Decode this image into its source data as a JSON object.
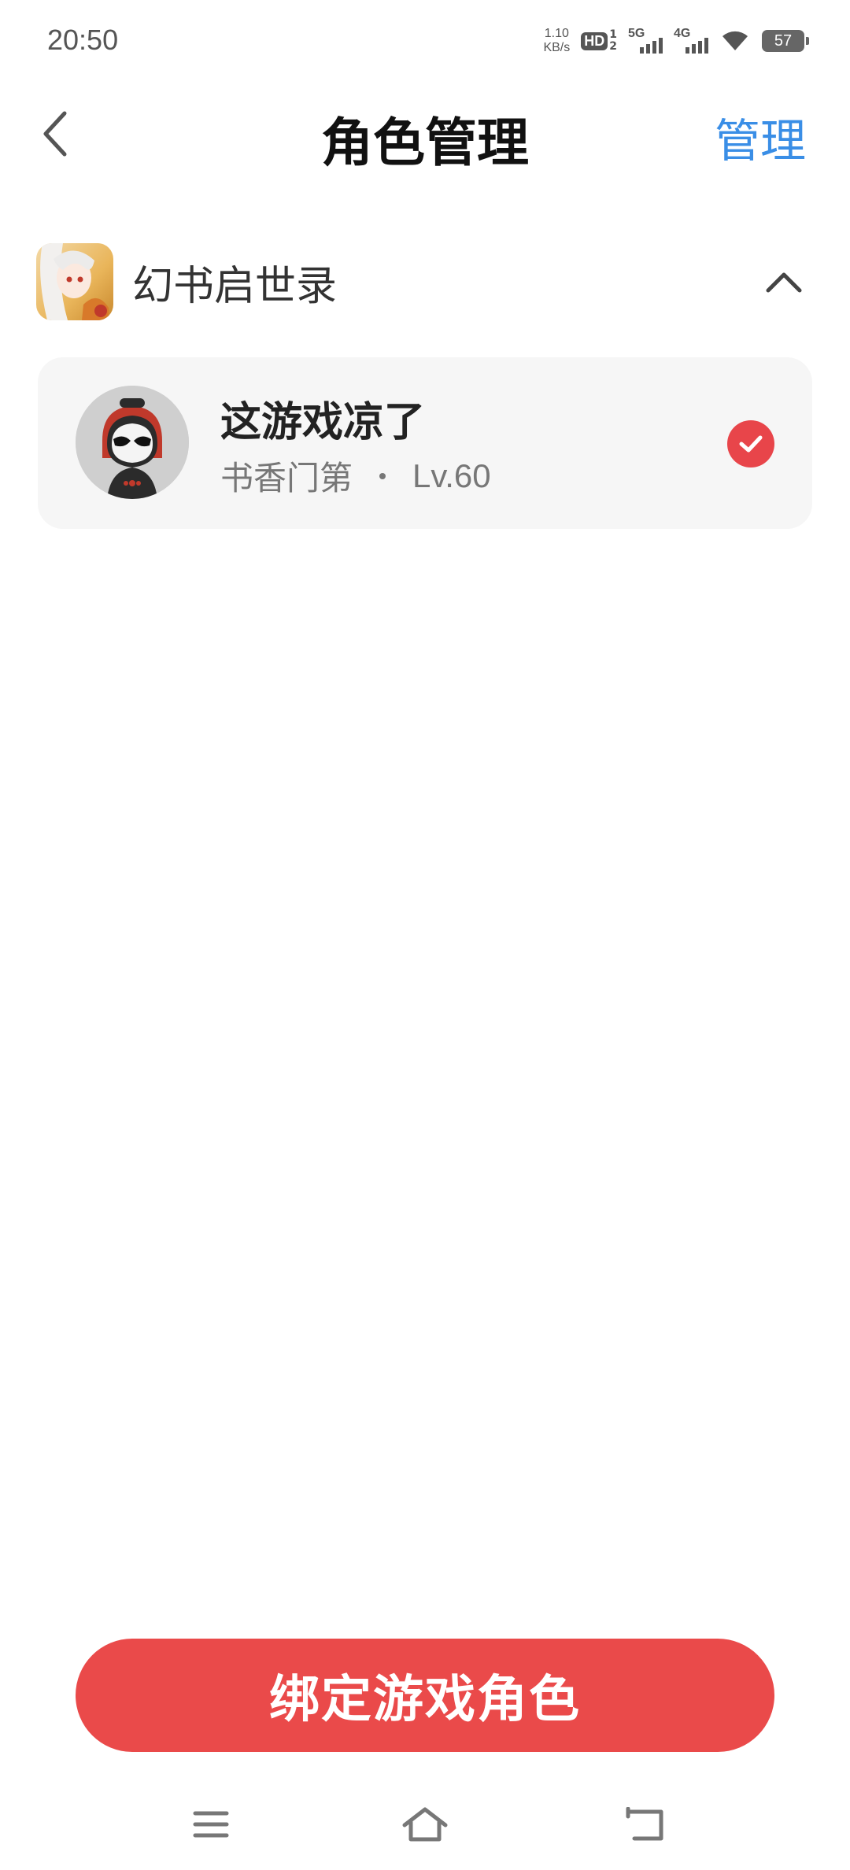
{
  "status_bar": {
    "time": "20:50",
    "net_speed_value": "1.10",
    "net_speed_unit": "KB/s",
    "hd_label": "HD",
    "hd_sub_top": "1",
    "hd_sub_bottom": "2",
    "signal1_label": "5G",
    "signal2_label": "4G",
    "battery": "57"
  },
  "header": {
    "title": "角色管理",
    "manage_label": "管理"
  },
  "game": {
    "name": "幻书启世录",
    "expanded": true
  },
  "role": {
    "name": "这游戏凉了",
    "server": "书香门第",
    "level": "Lv.60",
    "selected": true
  },
  "bind_button": {
    "label": "绑定游戏角色"
  },
  "colors": {
    "accent_blue": "#3a8ee6",
    "accent_red": "#ea4a4a",
    "card_bg": "#f6f6f6"
  },
  "icons": {
    "back": "chevron-left-icon",
    "collapse": "chevron-up-icon",
    "check": "check-icon",
    "nav_menu": "menu-icon",
    "nav_home": "home-icon",
    "nav_back": "back-icon"
  }
}
